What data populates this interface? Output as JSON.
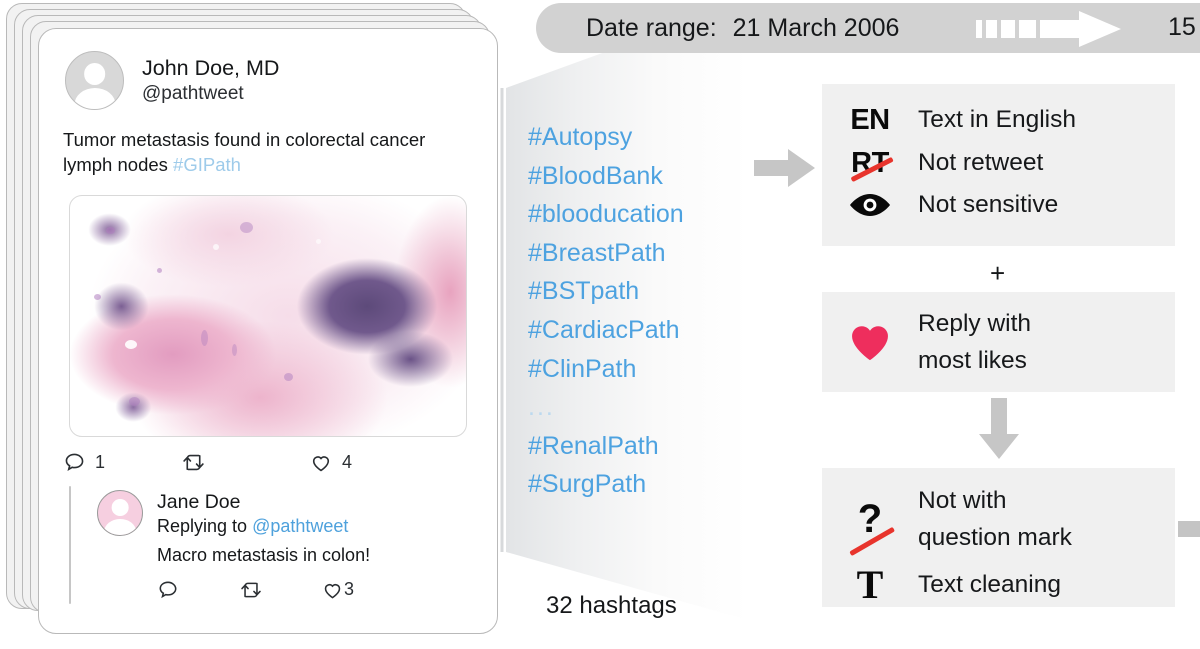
{
  "header": {
    "date_range_label": "Date range:",
    "date_range_value": "21 March 2006",
    "progress_arrow_icon": "segmented-right-arrow-icon",
    "end_value": "15"
  },
  "tweet": {
    "author_name": "John Doe, MD",
    "author_handle": "@pathtweet",
    "avatar_icon": "user-avatar-icon",
    "body_text": "Tumor metastasis found in colorectal cancer lymph nodes ",
    "body_hashtag": "#GIPath",
    "image_alt": "histology-slide-image",
    "engagement": {
      "reply_icon": "comment-icon",
      "reply_count": "1",
      "retweet_icon": "retweet-icon",
      "retweet_count": "",
      "like_icon": "heart-outline-icon",
      "like_count": "4"
    },
    "reply": {
      "avatar_icon": "user-avatar-pink-icon",
      "author_name": "Jane Doe",
      "replying_to_prefix": "Replying to ",
      "replying_to_handle": "@pathtweet",
      "body_text": "Macro metastasis in colon!",
      "engagement": {
        "reply_icon": "comment-icon",
        "reply_count": "",
        "retweet_icon": "retweet-icon",
        "retweet_count": "",
        "like_icon": "heart-outline-icon",
        "like_count": "3"
      }
    }
  },
  "hashtags": {
    "items": [
      "#Autopsy",
      "#BloodBank",
      "#blooducation",
      "#BreastPath",
      "#BSTpath",
      "#CardiacPath",
      "#ClinPath"
    ],
    "ellipsis": "...",
    "tail_items": [
      "#RenalPath",
      "#SurgPath"
    ],
    "count_label": "32 hashtags",
    "accent_color": "#4da2e0"
  },
  "filters": {
    "arrow_icon": "right-arrow-icon",
    "box_one": [
      {
        "icon": "en-language-icon",
        "icon_text": "EN",
        "label": "Text in English"
      },
      {
        "icon": "no-retweet-icon",
        "icon_text": "RT",
        "label": "Not retweet"
      },
      {
        "icon": "eye-icon",
        "icon_text": "",
        "label": "Not sensitive"
      }
    ],
    "plus_symbol": "+",
    "box_two": {
      "icon": "heart-filled-icon",
      "label_line1": "Reply with",
      "label_line2": "most likes",
      "heart_color": "#ee2e5d"
    },
    "down_arrow_icon": "down-arrow-icon",
    "box_three": [
      {
        "icon": "no-question-mark-icon",
        "icon_text": "?",
        "label_line1": "Not with",
        "label_line2": "question mark"
      },
      {
        "icon": "text-cleaning-icon",
        "icon_text": "T",
        "label_line1": "Text cleaning",
        "label_line2": ""
      }
    ],
    "strike_color": "#e8342c"
  }
}
